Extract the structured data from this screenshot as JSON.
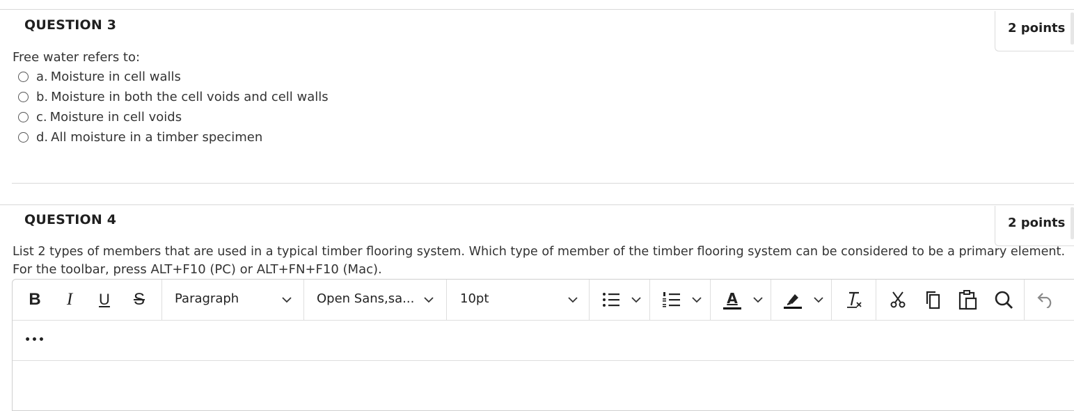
{
  "q3": {
    "title": "QUESTION 3",
    "points": "2 points",
    "prompt": "Free water refers to:",
    "options": [
      {
        "letter": "a.",
        "text": "Moisture in cell walls"
      },
      {
        "letter": "b.",
        "text": "Moisture in both the cell voids and cell walls"
      },
      {
        "letter": "c.",
        "text": "Moisture in cell voids"
      },
      {
        "letter": "d.",
        "text": "All moisture in a timber specimen"
      }
    ]
  },
  "q4": {
    "title": "QUESTION 4",
    "points": "2 points",
    "prompt": "List 2 types of members that are used in a typical timber flooring system. Which type of member of the timber flooring system can be considered to be a primary element.",
    "toolbar_hint": "For the toolbar, press ALT+F10 (PC) or ALT+FN+F10 (Mac)."
  },
  "editor": {
    "bold_label": "B",
    "italic_label": "I",
    "underline_label": "U",
    "strike_label": "S",
    "block_format": "Paragraph",
    "font_family": "Open Sans,sa...",
    "font_size": "10pt",
    "text_color_label": "A",
    "clear_format_label": "Tx",
    "more_label": "•••",
    "icons": [
      "bold-icon",
      "italic-icon",
      "underline-icon",
      "strikethrough-icon",
      "chevron-down-icon",
      "bullet-list-icon",
      "numbered-list-icon",
      "text-color-icon",
      "highlight-icon",
      "clear-formatting-icon",
      "cut-icon",
      "copy-icon",
      "paste-icon",
      "search-icon",
      "undo-icon",
      "more-icon"
    ]
  }
}
